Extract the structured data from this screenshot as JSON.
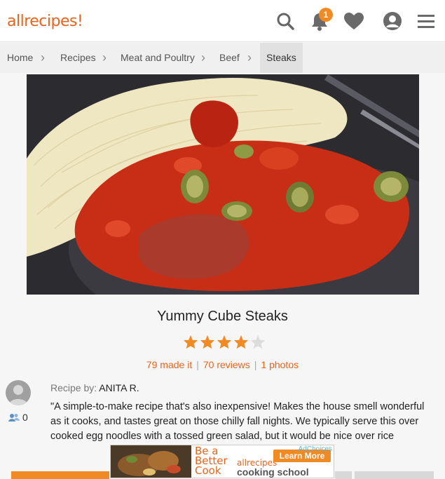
{
  "header": {
    "logo_text": "allrecipes",
    "logo_mark": "!",
    "notification_count": "1",
    "icons": [
      "search-icon",
      "bell-icon",
      "heart-icon",
      "profile-icon",
      "menu-icon"
    ],
    "accent_color": "#e8641c"
  },
  "breadcrumb": [
    "Home",
    "Recipes",
    "Meat and Poultry",
    "Beef",
    "Steaks"
  ],
  "recipe": {
    "title": "Yummy Cube Steaks",
    "rating": 4,
    "rating_max": 5,
    "made_it": "79 made it",
    "reviews": "70 reviews",
    "photos": "1 photos",
    "byline_label": "Recipe by:",
    "author": "ANITA R.",
    "followers": "0",
    "description": "\"A simple-to-make recipe that's also inexpensive! Makes the house smell wonderful as it cooks, and tastes great on those chilly fall nights. We typically serve this over cooked egg noodles with a tossed green salad, but it would be nice over rice"
  },
  "ad": {
    "headline": "Be a Better Cook",
    "brand": "allrecipes",
    "tagline": "cooking school",
    "cta": "Learn More",
    "choices": "AdChoices"
  }
}
